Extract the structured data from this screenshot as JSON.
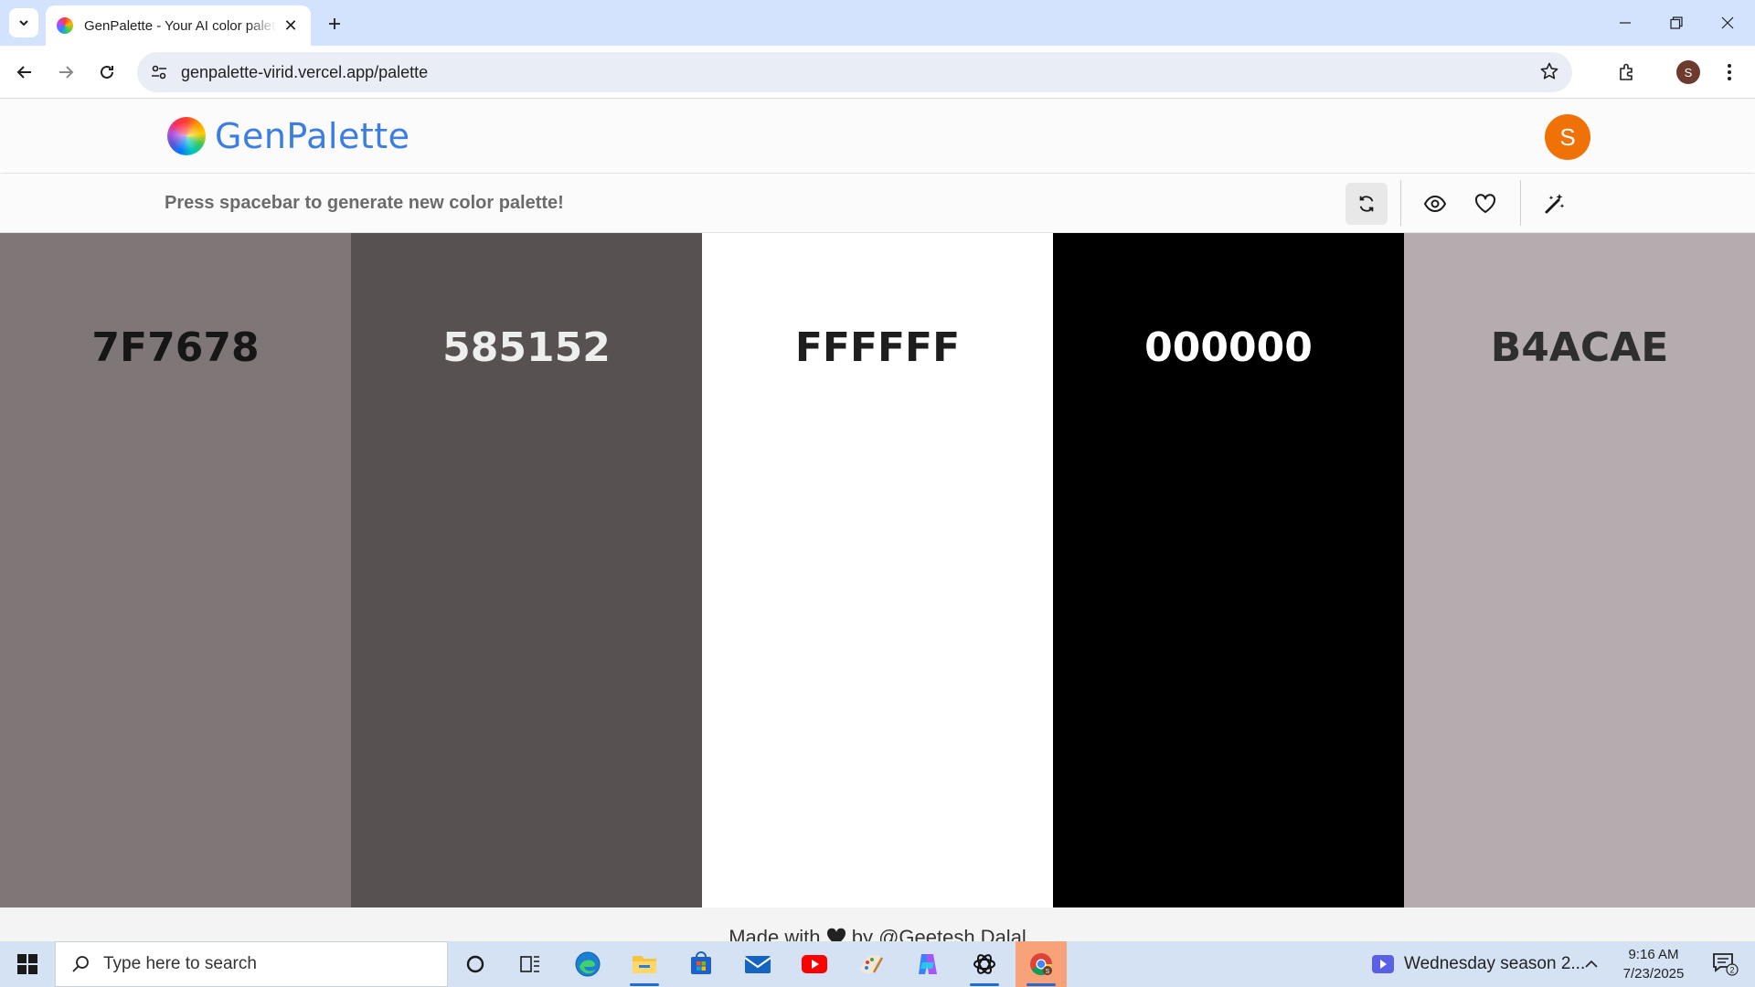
{
  "browser": {
    "tab_title": "GenPalette - Your AI color palette generator",
    "url": "genpalette-virid.vercel.app/palette",
    "profile_initial": "S",
    "icons": [
      "tab-search-icon",
      "close-icon",
      "plus-icon",
      "minimize-icon",
      "restore-icon",
      "close-window-icon",
      "back-icon",
      "forward-icon",
      "reload-icon",
      "site-info-icon",
      "star-icon",
      "extensions-icon",
      "more-icon"
    ]
  },
  "app": {
    "logo_text": "GenPalette",
    "avatar_initial": "S",
    "avatar_color": "#f07206",
    "logo_color": "#3b7de0",
    "hint": "Press spacebar to generate new color palette!",
    "actions": [
      "refresh-icon",
      "eye-icon",
      "heart-icon",
      "magic-wand-icon"
    ]
  },
  "palette": {
    "swatches": [
      {
        "hex": "7F7678",
        "bg": "#7f7678",
        "fg": "#161616"
      },
      {
        "hex": "585152",
        "bg": "#585152",
        "fg": "#eeeeee"
      },
      {
        "hex": "FFFFFF",
        "bg": "#ffffff",
        "fg": "#1e1e1e"
      },
      {
        "hex": "000000",
        "bg": "#000000",
        "fg": "#ffffff"
      },
      {
        "hex": "B4ACAE",
        "bg": "#b4acae",
        "fg": "#2e2e2e"
      }
    ]
  },
  "footer": {
    "before": "Made with",
    "after": "by @Geetesh Dalal"
  },
  "taskbar": {
    "search_placeholder": "Type here to search",
    "news_text": "Wednesday season 2...",
    "time": "9:16 AM",
    "date": "7/23/2025",
    "notification_count": "2",
    "apps": [
      "cortana-icon",
      "task-view-icon",
      "edge-icon",
      "file-explorer-icon",
      "store-icon",
      "mail-icon",
      "youtube-icon",
      "paint-icon",
      "copilot-icon",
      "chatgpt-icon",
      "chrome-icon"
    ]
  }
}
